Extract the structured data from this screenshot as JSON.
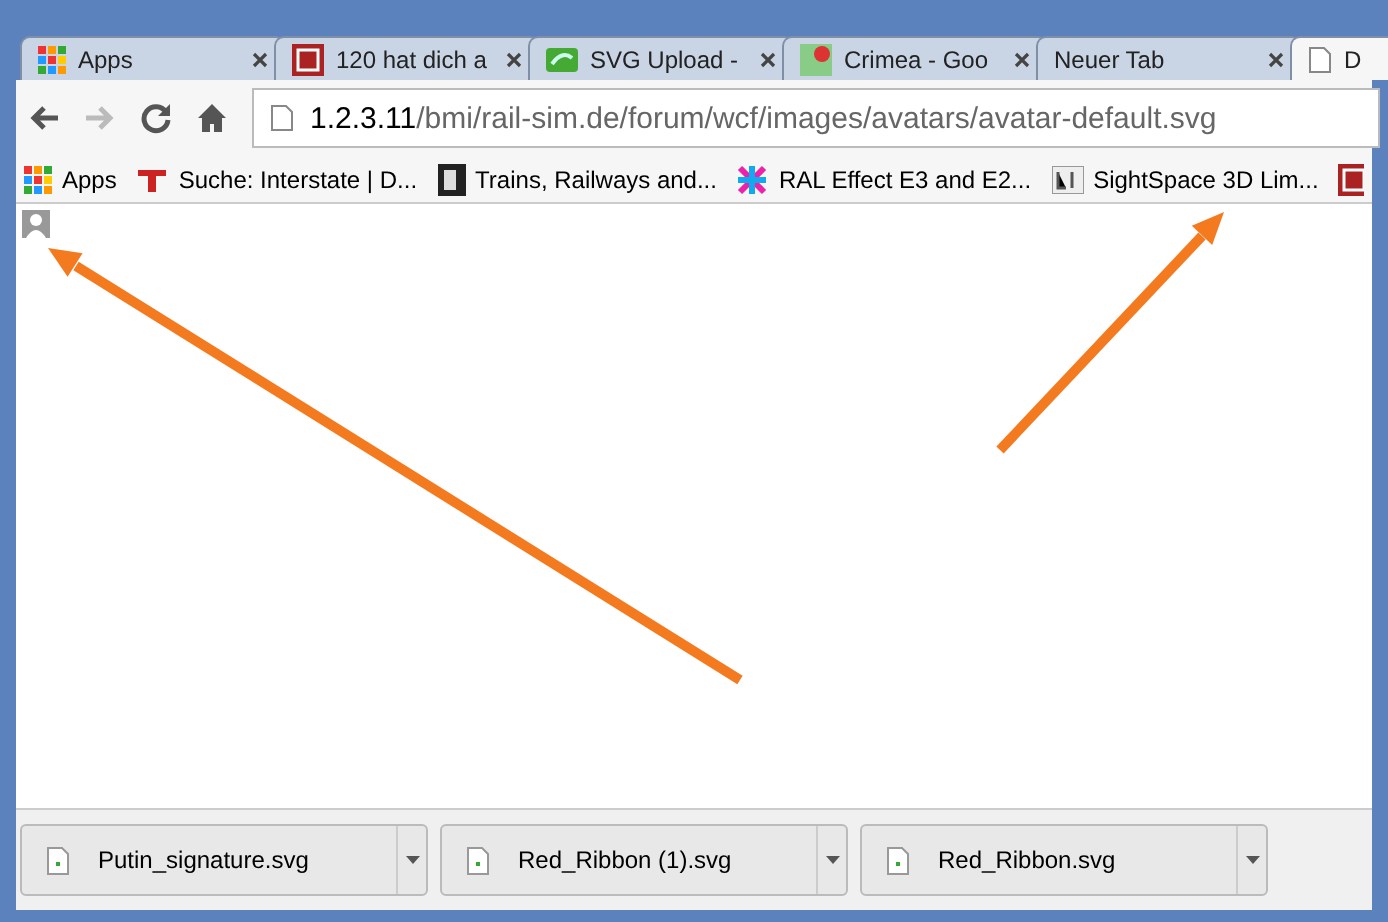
{
  "tabs": [
    {
      "title": "Apps",
      "selected": false
    },
    {
      "title": "120 hat dich a",
      "selected": false
    },
    {
      "title": "SVG Upload -",
      "selected": false
    },
    {
      "title": "Crimea - Goo",
      "selected": false
    },
    {
      "title": "Neuer Tab",
      "selected": false
    },
    {
      "title": "D",
      "selected": true
    }
  ],
  "address": {
    "host": "1.2.3.11",
    "path": "/bmi/rail-sim.de/forum/wcf/images/avatars/avatar-default.svg"
  },
  "bookmarks": [
    {
      "title": "Apps"
    },
    {
      "title": "Suche: Interstate | D..."
    },
    {
      "title": "Trains, Railways and..."
    },
    {
      "title": "RAL Effect E3 and E2..."
    },
    {
      "title": "SightSpace 3D Lim..."
    }
  ],
  "downloads": [
    {
      "name": "Putin_signature.svg"
    },
    {
      "name": "Red_Ribbon (1).svg"
    },
    {
      "name": "Red_Ribbon.svg"
    }
  ]
}
